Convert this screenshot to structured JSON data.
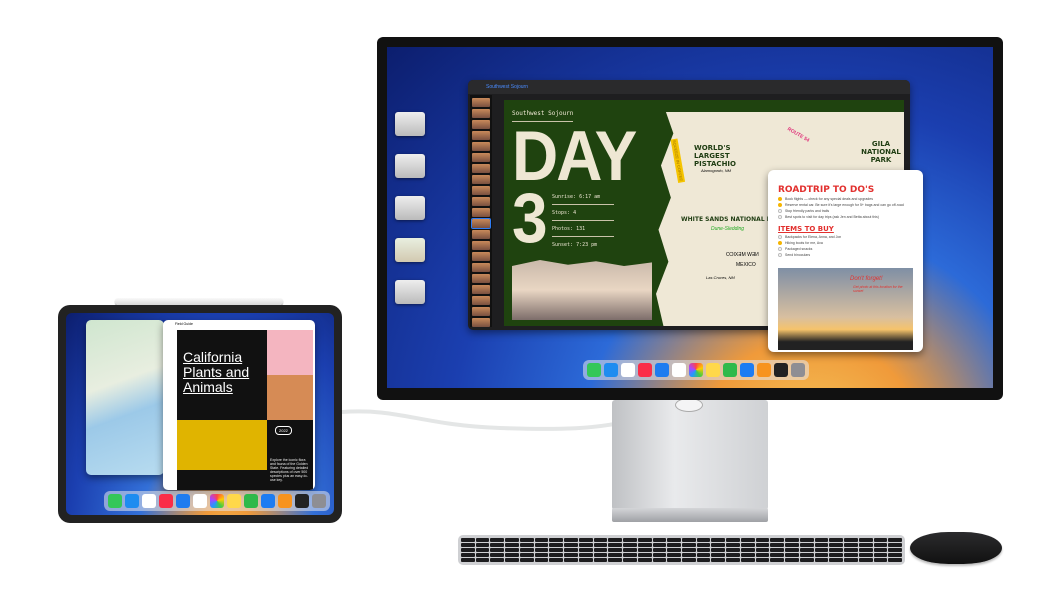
{
  "keynote": {
    "document_title": "Southwest Sojourn",
    "slide": {
      "header": "Southwest Sojourn",
      "big_title_1": "DAY",
      "big_title_2": "3",
      "stats": [
        "Sunrise: 6:17 am",
        "Stops: 4",
        "Photos: 131",
        "Sunset: 7:23 pm"
      ],
      "map_labels": [
        "WORLD'S LARGEST PISTACHIO",
        "Alamogordo, NM",
        "WHITE SANDS NATIONAL PARK",
        "Dune-Sledding",
        "GILA NATIONAL PARK",
        "ROUTE 54",
        "NEW MEXICO",
        "MEXICO",
        "Las Cruces, NM",
        "SQUEEZE IN COFFEE"
      ]
    }
  },
  "notes": {
    "heading1": "ROADTRIP TO DO'S",
    "todos": [
      {
        "text": "Book flights — check for any special deals and upgrades",
        "done": true
      },
      {
        "text": "Reserve rental car. Be sure it's large enough for 5+ bags and can go off-road",
        "done": true
      },
      {
        "text": "Stop friendly parks and trails",
        "done": false
      },
      {
        "text": "Best spots to visit for day trips (ask Jen and Betta about this)",
        "done": false
      }
    ],
    "heading2": "ITEMS TO BUY",
    "items": [
      {
        "text": "Backpacks for Elena, Anna, and Jon",
        "done": false
      },
      {
        "text": "Hiking boots for me, Ava",
        "done": true
      },
      {
        "text": "Packaged snacks",
        "done": false
      },
      {
        "text": "Send binoculars",
        "done": false
      }
    ],
    "photo_note": "Don't forget!",
    "photo_subnote": "Get photo at this location for the sunset"
  },
  "ipad": {
    "pages_doc_title": "Field Guide",
    "title": "California Plants and Animals",
    "year": "2022",
    "description": "Explore the iconic flora and fauna of the Golden State. Featuring detailed descriptions of over 500 species plus an easy-to-use key."
  },
  "dock_icons": [
    "messages",
    "safari",
    "reminders",
    "music",
    "mail",
    "calendar",
    "photos",
    "notes",
    "numbers",
    "keynote",
    "pages",
    "freeform",
    "settings"
  ],
  "colors": {
    "accent": "#4a8cff",
    "slide_bg": "#1f430f",
    "notes_red": "#e2302e"
  }
}
